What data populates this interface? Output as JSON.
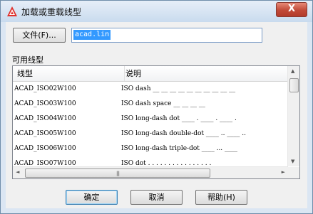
{
  "window": {
    "title": "加载或重载线型",
    "close_glyph": "X"
  },
  "file": {
    "button_label": "文件(F)...",
    "value": "acad.lin"
  },
  "list": {
    "group_label": "可用线型",
    "columns": [
      "线型",
      "说明"
    ],
    "rows": [
      {
        "name": "ACAD_ISO02W100",
        "desc": "ISO dash __ __ __ __ __ __ __ __ __ __"
      },
      {
        "name": "ACAD_ISO03W100",
        "desc": "ISO dash space __    __    __    __"
      },
      {
        "name": "ACAD_ISO04W100",
        "desc": "ISO long-dash dot ____ . ____ . ____ ."
      },
      {
        "name": "ACAD_ISO05W100",
        "desc": "ISO long-dash double-dot ____ .. ____ .."
      },
      {
        "name": "ACAD_ISO06W100",
        "desc": "ISO long-dash triple-dot ____ ... ____"
      },
      {
        "name": "ACAD_ISO07W100",
        "desc": "ISO dot . . . . . . . . . . . . . . . ."
      }
    ],
    "scroll": {
      "up": "▲",
      "down": "▼",
      "left": "◄",
      "right": "►",
      "grip": "|||"
    }
  },
  "buttons": {
    "ok": "确定",
    "cancel": "取消",
    "help": "帮助(H)"
  },
  "colors": {
    "selection": "#3399ff",
    "title_gradient_top": "#e6eef8",
    "close": "#c14a38"
  }
}
